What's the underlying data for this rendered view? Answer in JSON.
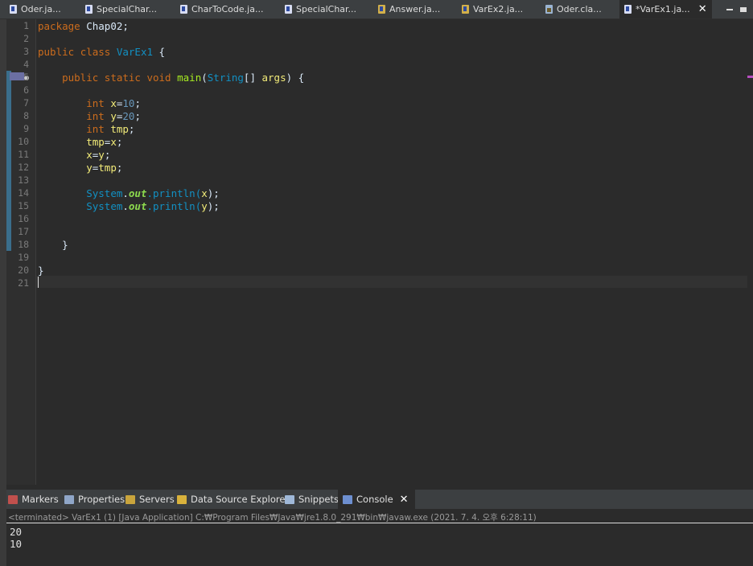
{
  "editor_tabs": [
    {
      "label": "Oder.ja...",
      "icon": "java-file-icon"
    },
    {
      "label": "SpecialChar...",
      "icon": "java-file-icon"
    },
    {
      "label": "CharToCode.ja...",
      "icon": "java-file-icon"
    },
    {
      "label": "SpecialChar...",
      "icon": "java-file-icon"
    },
    {
      "label": "Answer.ja...",
      "icon": "runnable-java-file-icon"
    },
    {
      "label": "VarEx2.ja...",
      "icon": "runnable-java-file-icon"
    },
    {
      "label": "Oder.cla...",
      "icon": "class-file-icon"
    },
    {
      "label": "*VarEx1.ja...",
      "icon": "java-file-icon",
      "active": true,
      "close": "✕"
    }
  ],
  "line_numbers": [
    "1",
    "2",
    "3",
    "4",
    "5",
    "6",
    "7",
    "8",
    "9",
    "10",
    "11",
    "12",
    "13",
    "14",
    "15",
    "16",
    "17",
    "18",
    "19",
    "20",
    "21"
  ],
  "code": {
    "l1": {
      "kw": "package",
      "rest": " Chap02;"
    },
    "l3": {
      "kw1": "public",
      "kw2": "class",
      "cls": "VarEx1",
      "rest": " {"
    },
    "l5": {
      "kw1": "public",
      "kw2": "static",
      "kw3": "void",
      "meth": "main",
      "p1": "(",
      "typ": "String",
      "p2": "[] ",
      "var": "args",
      "rest": ") {"
    },
    "l7": {
      "kw": "int",
      "var": "x",
      "eq": "=",
      "num": "10",
      "end": ";"
    },
    "l8": {
      "kw": "int",
      "var": "y",
      "eq": "=",
      "num": "20",
      "end": ";"
    },
    "l9": {
      "kw": "int",
      "var": "tmp",
      "end": ";"
    },
    "l10": {
      "v1": "tmp",
      "eq": "=",
      "v2": "x",
      "end": ";"
    },
    "l11": {
      "v1": "x",
      "eq": "=",
      "v2": "y",
      "end": ";"
    },
    "l12": {
      "v1": "y",
      "eq": "=",
      "v2": "tmp",
      "end": ";"
    },
    "l14": {
      "cls": "System",
      "dot": ".",
      "fld": "out",
      "call": ".println(",
      "arg": "x",
      "end": ");"
    },
    "l15": {
      "cls": "System",
      "dot": ".",
      "fld": "out",
      "call": ".println(",
      "arg": "y",
      "end": ");"
    },
    "l18": "}",
    "l20": "}"
  },
  "panel_tabs": [
    {
      "label": "Markers",
      "icon": "markers-icon"
    },
    {
      "label": "Properties",
      "icon": "properties-icon"
    },
    {
      "label": "Servers",
      "icon": "servers-icon"
    },
    {
      "label": "Data Source Explorer",
      "icon": "data-source-explorer-icon"
    },
    {
      "label": "Snippets",
      "icon": "snippets-icon"
    },
    {
      "label": "Console",
      "icon": "console-icon",
      "active": true,
      "close": "✕"
    }
  ],
  "console": {
    "header": "<terminated> VarEx1 (1) [Java Application] C:₩Program Files₩Java₩jre1.8.0_291₩bin₩javaw.exe  (2021. 7. 4. 오후 6:28:11)",
    "output": [
      "20",
      "10"
    ]
  }
}
